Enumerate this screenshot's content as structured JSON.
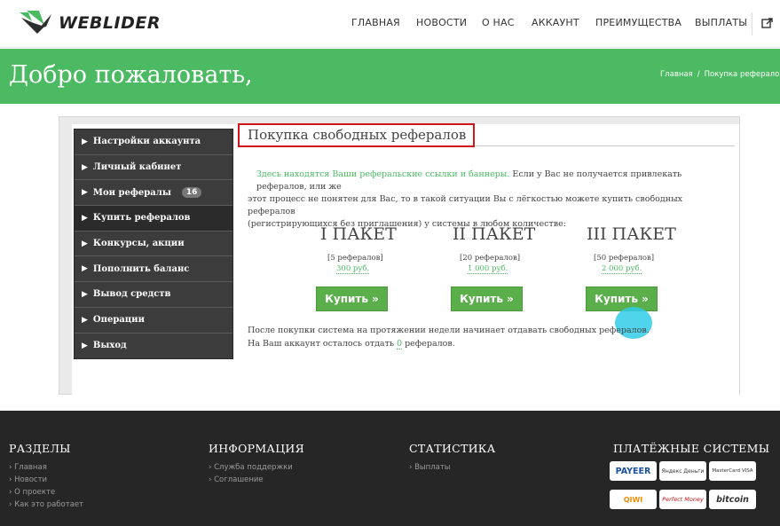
{
  "header": {
    "logo_text": "WEBLIDER",
    "nav": [
      "ГЛАВНАЯ",
      "НОВОСТИ",
      "О НАС",
      "АККАУНТ",
      "ПРЕИМУЩЕСТВА",
      "ВЫПЛАТЫ"
    ]
  },
  "banner": {
    "title": "Добро пожаловать,",
    "breadcrumb_home": "Главная",
    "breadcrumb_sep": "/",
    "breadcrumb_current": "Покупка рефералов"
  },
  "sidebar": {
    "items": [
      {
        "label": "Настройки аккаунта"
      },
      {
        "label": "Личный кабинет"
      },
      {
        "label": "Мои рефералы",
        "badge": "16"
      },
      {
        "label": "Купить рефералов"
      },
      {
        "label": "Конкурсы, акции"
      },
      {
        "label": "Пополнить баланс"
      },
      {
        "label": "Вывод средств"
      },
      {
        "label": "Операции"
      },
      {
        "label": "Выход"
      }
    ]
  },
  "main": {
    "title": "Покупка свободных рефералов",
    "desc_link": "Здесь находятся Ваши реферальские ссылки и баннеры.",
    "desc_line1": " Если у Вас не получается привлекать рефералов, или же",
    "desc_line2": "этот процесс не понятен для Вас, то в такой ситуации Вы с лёгкостью можете купить свободных рефералов",
    "desc_line3": "(регистрирующихся без приглашения) у системы в любом количестве:",
    "packages": [
      {
        "title": "I ПАКЕТ",
        "count": "[5 рефералов]",
        "price": "300 руб.",
        "button": "Купить »"
      },
      {
        "title": "II ПАКЕТ",
        "count": "[20 рефералов]",
        "price": "1 000 руб.",
        "button": "Купить »"
      },
      {
        "title": "III ПАКЕТ",
        "count": "[50 рефералов]",
        "price": "2 000 руб.",
        "button": "Купить »"
      }
    ],
    "after_line1": "После покупки система на протяжении недели начинает отдавать свободных рефералов.",
    "after_line2_pre": "На Ваш аккаунт осталось отдать ",
    "after_line2_num": "0",
    "after_line2_post": " рефералов."
  },
  "footer": {
    "sections": {
      "title": "РАЗДЕЛЫ",
      "links": [
        "› Главная",
        "› Новости",
        "› О проекте",
        "› Как это работает"
      ]
    },
    "info": {
      "title": "ИНФОРМАЦИЯ",
      "links": [
        "› Служба поддержки",
        "› Соглашение"
      ]
    },
    "stats": {
      "title": "СТАТИСТИКА",
      "links": [
        "› Выплаты"
      ]
    },
    "payments": {
      "title": "ПЛАТЁЖНЫЕ СИСТЕМЫ",
      "logos": [
        "PAYEER",
        "Яндекс Деньги",
        "MasterCard VISA",
        "QIWI",
        "Perfect Money",
        "bitcoin"
      ]
    }
  },
  "colors": {
    "accent_green": "#4cb963",
    "button_green": "#5aaf4b",
    "highlight_red": "#d0161b",
    "sidebar_dark": "#3c3c3c",
    "footer_dark": "#262626"
  }
}
